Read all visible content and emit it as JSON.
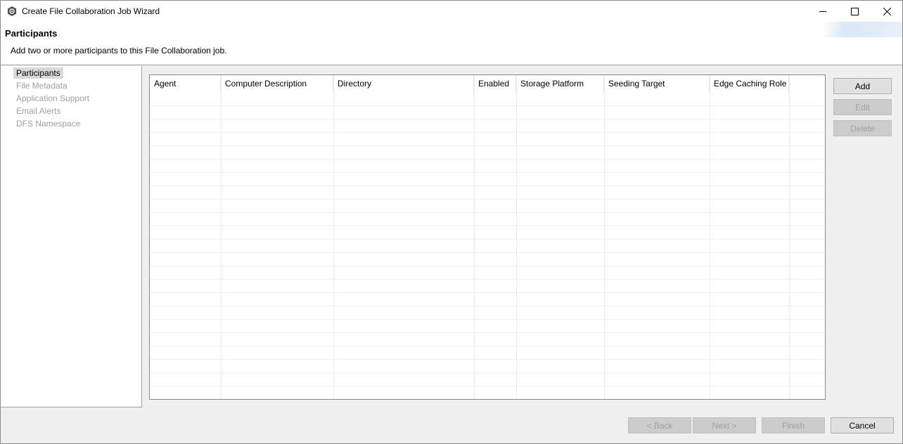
{
  "window": {
    "title": "Create File Collaboration Job Wizard"
  },
  "header": {
    "title": "Participants",
    "description": "Add two or more participants to this File Collaboration job."
  },
  "nav": {
    "items": [
      {
        "label": "Participants",
        "active": true
      },
      {
        "label": "File Metadata",
        "active": false
      },
      {
        "label": "Application Support",
        "active": false
      },
      {
        "label": "Email Alerts",
        "active": false
      },
      {
        "label": "DFS Namespace",
        "active": false
      }
    ]
  },
  "table": {
    "columns": [
      "Agent",
      "Computer Description",
      "Directory",
      "Enabled",
      "Storage Platform",
      "Seeding Target",
      "Edge Caching Role"
    ],
    "rows": []
  },
  "side_buttons": {
    "add": "Add",
    "edit": "Edit",
    "delete": "Delete"
  },
  "footer": {
    "back": "< Back",
    "next": "Next >",
    "finish": "Finish",
    "cancel": "Cancel"
  },
  "icons": {
    "app": "app-gear-icon",
    "minimize": "minimize-icon",
    "maximize": "maximize-icon",
    "close": "close-icon"
  }
}
